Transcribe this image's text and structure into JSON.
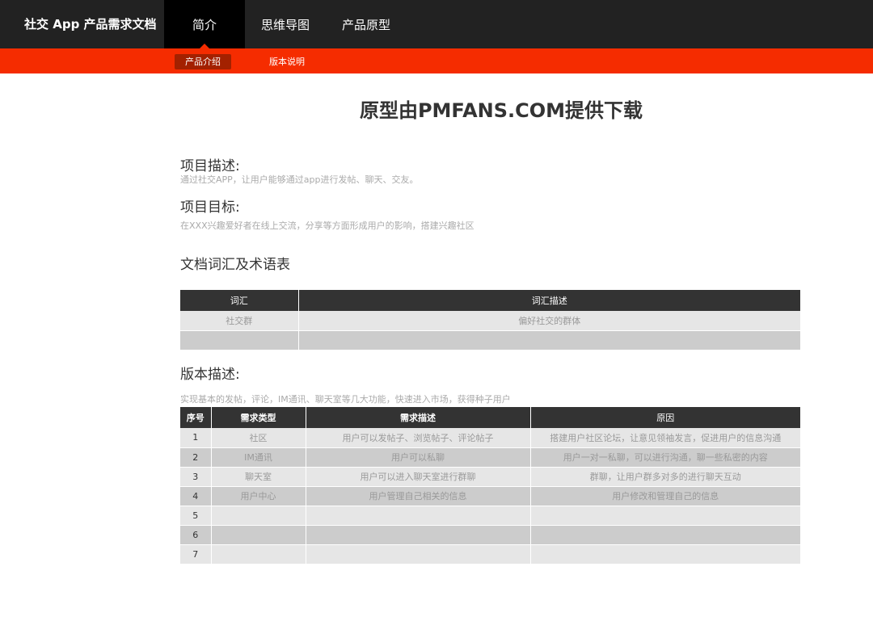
{
  "header": {
    "app_title": "社交 App 产品需求文档",
    "tabs": [
      {
        "label": "简介",
        "active": true
      },
      {
        "label": "思维导图",
        "active": false
      },
      {
        "label": "产品原型",
        "active": false
      }
    ]
  },
  "subnav": {
    "tabs": [
      {
        "label": "产品介绍",
        "active": true
      },
      {
        "label": "版本说明",
        "active": false
      }
    ]
  },
  "page_title": "原型由PMFANS.COM提供下载",
  "project_desc": {
    "heading": "项目描述:",
    "text": "通过社交APP，让用户能够通过app进行发帖、聊天、交友。"
  },
  "project_goal": {
    "heading": "项目目标:",
    "text": "在XXX兴趣爱好者在线上交流，分享等方面形成用户的影响，搭建兴趣社区"
  },
  "glossary": {
    "heading": "文档词汇及术语表",
    "columns": [
      "词汇",
      "词汇描述"
    ],
    "rows": [
      [
        "社交群",
        "偏好社交的群体"
      ],
      [
        "",
        ""
      ]
    ]
  },
  "version": {
    "heading": "版本描述:",
    "text": "实现基本的发帖，评论，IM通讯、聊天室等几大功能，快速进入市场，获得种子用户",
    "columns": [
      "序号",
      "需求类型",
      "需求描述",
      "原因"
    ],
    "rows": [
      [
        "1",
        "社区",
        "用户可以发帖子、浏览帖子、评论帖子",
        "搭建用户社区论坛，让意见领袖发言，促进用户的信息沟通"
      ],
      [
        "2",
        "IM通讯",
        "用户可以私聊",
        "用户一对一私聊，可以进行沟通，聊一些私密的内容"
      ],
      [
        "3",
        "聊天室",
        "用户可以进入聊天室进行群聊",
        "群聊，让用户群多对多的进行聊天互动"
      ],
      [
        "4",
        "用户中心",
        "用户管理自己相关的信息",
        "用户修改和管理自己的信息"
      ],
      [
        "5",
        "",
        "",
        ""
      ],
      [
        "6",
        "",
        "",
        ""
      ],
      [
        "7",
        "",
        "",
        ""
      ]
    ]
  },
  "colors": {
    "topbar": "#222222",
    "accent": "#f52c00",
    "table_header": "#333333"
  }
}
